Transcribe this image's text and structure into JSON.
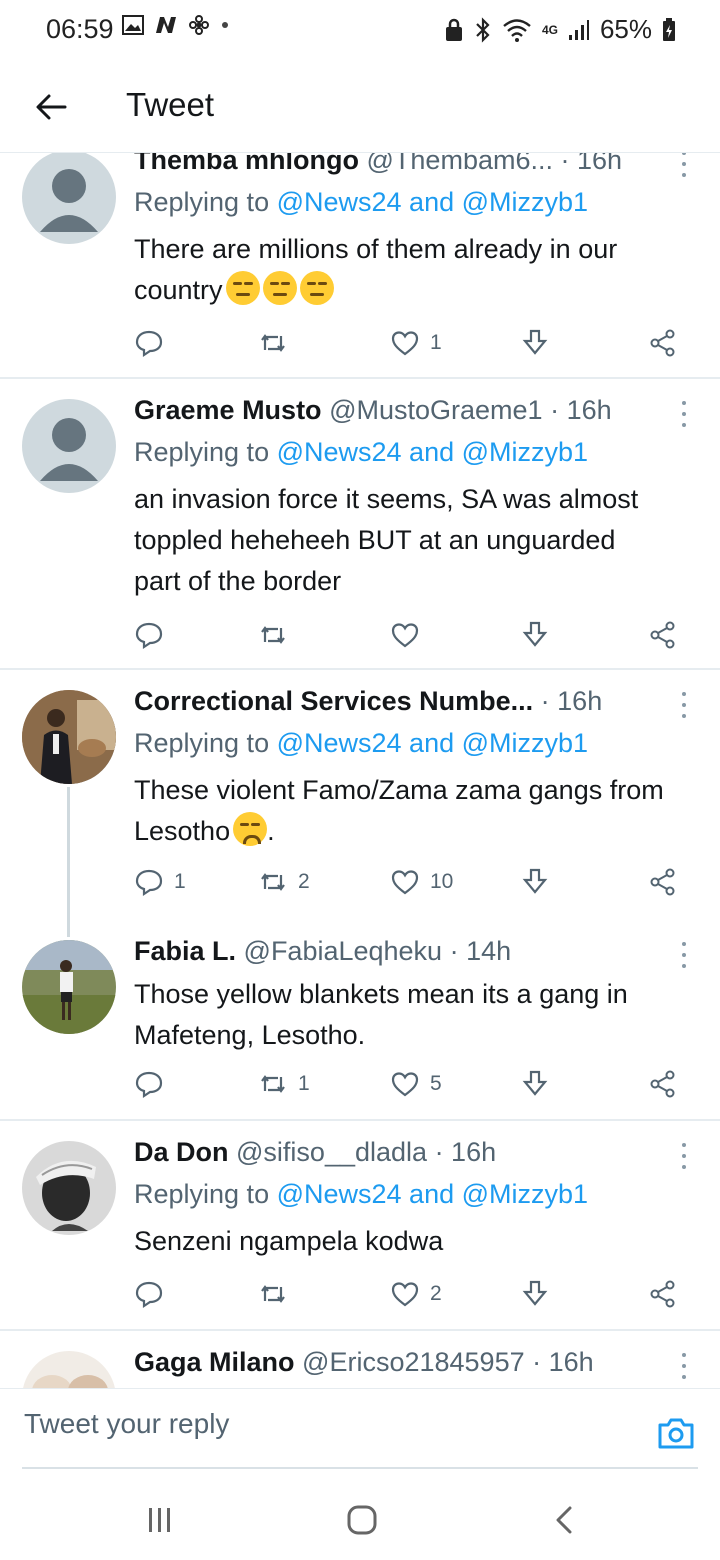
{
  "status": {
    "time": "06:59",
    "network": "4G",
    "battery": "65%"
  },
  "appbar": {
    "title": "Tweet"
  },
  "tweets": [
    {
      "name": "Themba mhlongo",
      "handle": "@Thembam6...",
      "time": "· 16h",
      "replying_prefix": "Replying to ",
      "replying_link": "@News24 and @Mizzyb1",
      "text": "There are millions of them already in our country",
      "emojis": "smirk x3",
      "reply_count": "",
      "retweet_count": "",
      "like_count": "1"
    },
    {
      "name": "Graeme Musto",
      "handle": "@MustoGraeme1",
      "time": "· 16h",
      "replying_prefix": "Replying to ",
      "replying_link": "@News24 and @Mizzyb1",
      "text": "an invasion force it seems, SA was almost toppled heheheeh BUT at an unguarded part of the border",
      "reply_count": "",
      "retweet_count": "",
      "like_count": ""
    },
    {
      "name": "Correctional Services Numbe...",
      "handle": "",
      "time": "· 16h",
      "replying_prefix": "Replying to ",
      "replying_link": "@News24 and @Mizzyb1",
      "text": "These violent Famo/Zama zama gangs from Lesotho",
      "text_suffix": ".",
      "reply_count": "1",
      "retweet_count": "2",
      "like_count": "10"
    },
    {
      "name": "Fabia L.",
      "handle": "@FabiaLeqheku",
      "time": "· 14h",
      "text": "Those yellow blankets mean its a gang in Mafeteng, Lesotho.",
      "reply_count": "",
      "retweet_count": "1",
      "like_count": "5"
    },
    {
      "name": "Da Don",
      "handle": "@sifiso__dladla",
      "time": "· 16h",
      "replying_prefix": "Replying to ",
      "replying_link": "@News24 and @Mizzyb1",
      "text": "Senzeni ngampela kodwa",
      "reply_count": "",
      "retweet_count": "",
      "like_count": "2"
    },
    {
      "name": "Gaga Milano",
      "handle": "@Ericso21845957",
      "time": "· 16h"
    }
  ],
  "compose": {
    "placeholder": "Tweet your reply"
  },
  "colors": {
    "link": "#1d9bf0",
    "muted": "#536471",
    "text": "#14171a"
  },
  "icons": [
    "back-arrow-icon",
    "reply-icon",
    "retweet-icon",
    "like-icon",
    "download-icon",
    "share-icon",
    "more-icon",
    "camera-icon",
    "recents-icon",
    "home-icon",
    "back-nav-icon"
  ]
}
